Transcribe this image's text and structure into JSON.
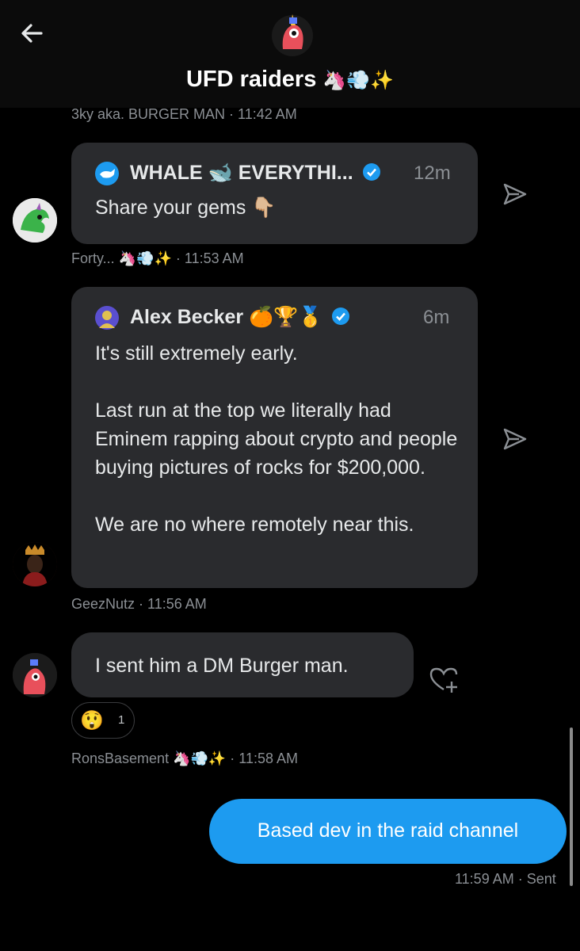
{
  "header": {
    "title": "UFD raiders",
    "title_emojis": "🦄💨✨",
    "back_icon": "back-arrow-icon"
  },
  "messages": [
    {
      "sender_meta": "3ky aka. BURGER MAN · 11:42 AM"
    },
    {
      "quote_author": "WHALE",
      "quote_author_emoji": "🐋",
      "quote_author_rest": "EVERYTHI...",
      "quote_time": "12m",
      "quote_text": "Share your gems 👇🏼",
      "sender_meta": "Forty... 🦄💨✨ · 11:53 AM"
    },
    {
      "quote_author": "Alex Becker",
      "quote_author_emojis": "🍊🏆🥇",
      "quote_time": "6m",
      "quote_text": "It's still extremely early.\n\nLast run at the top we literally had Eminem rapping about crypto and people buying pictures of rocks for $200,000.\n\nWe are no where remotely near this.",
      "sender_meta": "GeezNutz · 11:56 AM"
    },
    {
      "text": "I sent him a DM Burger man.",
      "reaction_emoji": "😲",
      "reaction_count": "1",
      "sender_meta": "RonsBasement 🦄💨✨ · 11:58 AM"
    },
    {
      "text": "Based dev in the raid channel",
      "status": "11:59 AM · Sent"
    }
  ],
  "colors": {
    "background": "#000000",
    "bubble": "#2a2b2e",
    "my_bubble": "#1d9bf0",
    "muted": "#8b8f94",
    "verified": "#1d9bf0"
  }
}
